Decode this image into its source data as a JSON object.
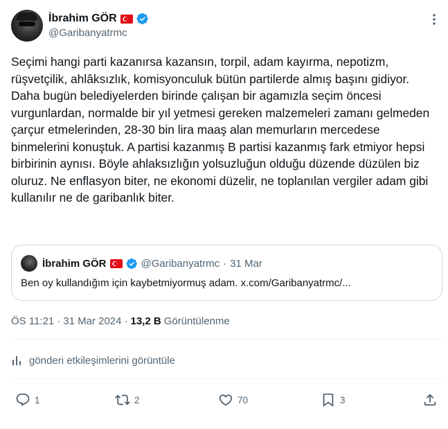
{
  "author": {
    "name": "İbrahim GÖR",
    "handle": "@Garibanyatrmc",
    "flag_color": "#e30a17",
    "verified_color": "#1d9bf0"
  },
  "tweet": {
    "text": "Seçimi hangi parti kazanırsa kazansın, torpil, adam kayırma, nepotizm, rüşvetçilik, ahlâksızlık, komisyonculuk bütün partilerde almış başını gidiyor. Daha bugün belediyelerden birinde çalışan bir agamızla seçim öncesi vurgunlardan, normalde bir yıl yetmesi gereken malzemeleri zamanı gelmeden çarçur etmelerinden, 28-30 bin lira maaş alan memurların mercedese binmelerini konuştuk. A partisi kazanmış B partisi kazanmış fark etmiyor hepsi birbirinin aynısı. Böyle ahlaksızlığın yolsuzluğun olduğu düzende düzülen biz oluruz. Ne enflasyon biter, ne ekonomi düzelir, ne toplanılan vergiler adam gibi kullanılır ne de garibanlık biter."
  },
  "quote": {
    "name": "İbrahim GÖR",
    "handle": "@Garibanyatrmc",
    "separator": "·",
    "date": "31 Mar",
    "text": "Ben oy kullandığım için kaybetmiyormuş adam. x.com/Garibanyatrmc/..."
  },
  "meta": {
    "time": "ÖS 11:21",
    "separator": "·",
    "date": "31 Mar 2024",
    "separator2": "·",
    "views": "13,2 B",
    "views_label": "Görüntülenme"
  },
  "engagements_label": "gönderi etkileşimlerini görüntüle",
  "actions": {
    "replies": "1",
    "reposts": "2",
    "likes": "70",
    "bookmarks": "3"
  },
  "icons": {
    "more": "more-dots-icon",
    "reply": "reply-icon",
    "repost": "repost-icon",
    "like": "heart-icon",
    "bookmark": "bookmark-icon",
    "share": "share-icon",
    "analytics": "analytics-icon",
    "verified": "verified-badge-icon",
    "flag": "turkey-flag-icon"
  }
}
